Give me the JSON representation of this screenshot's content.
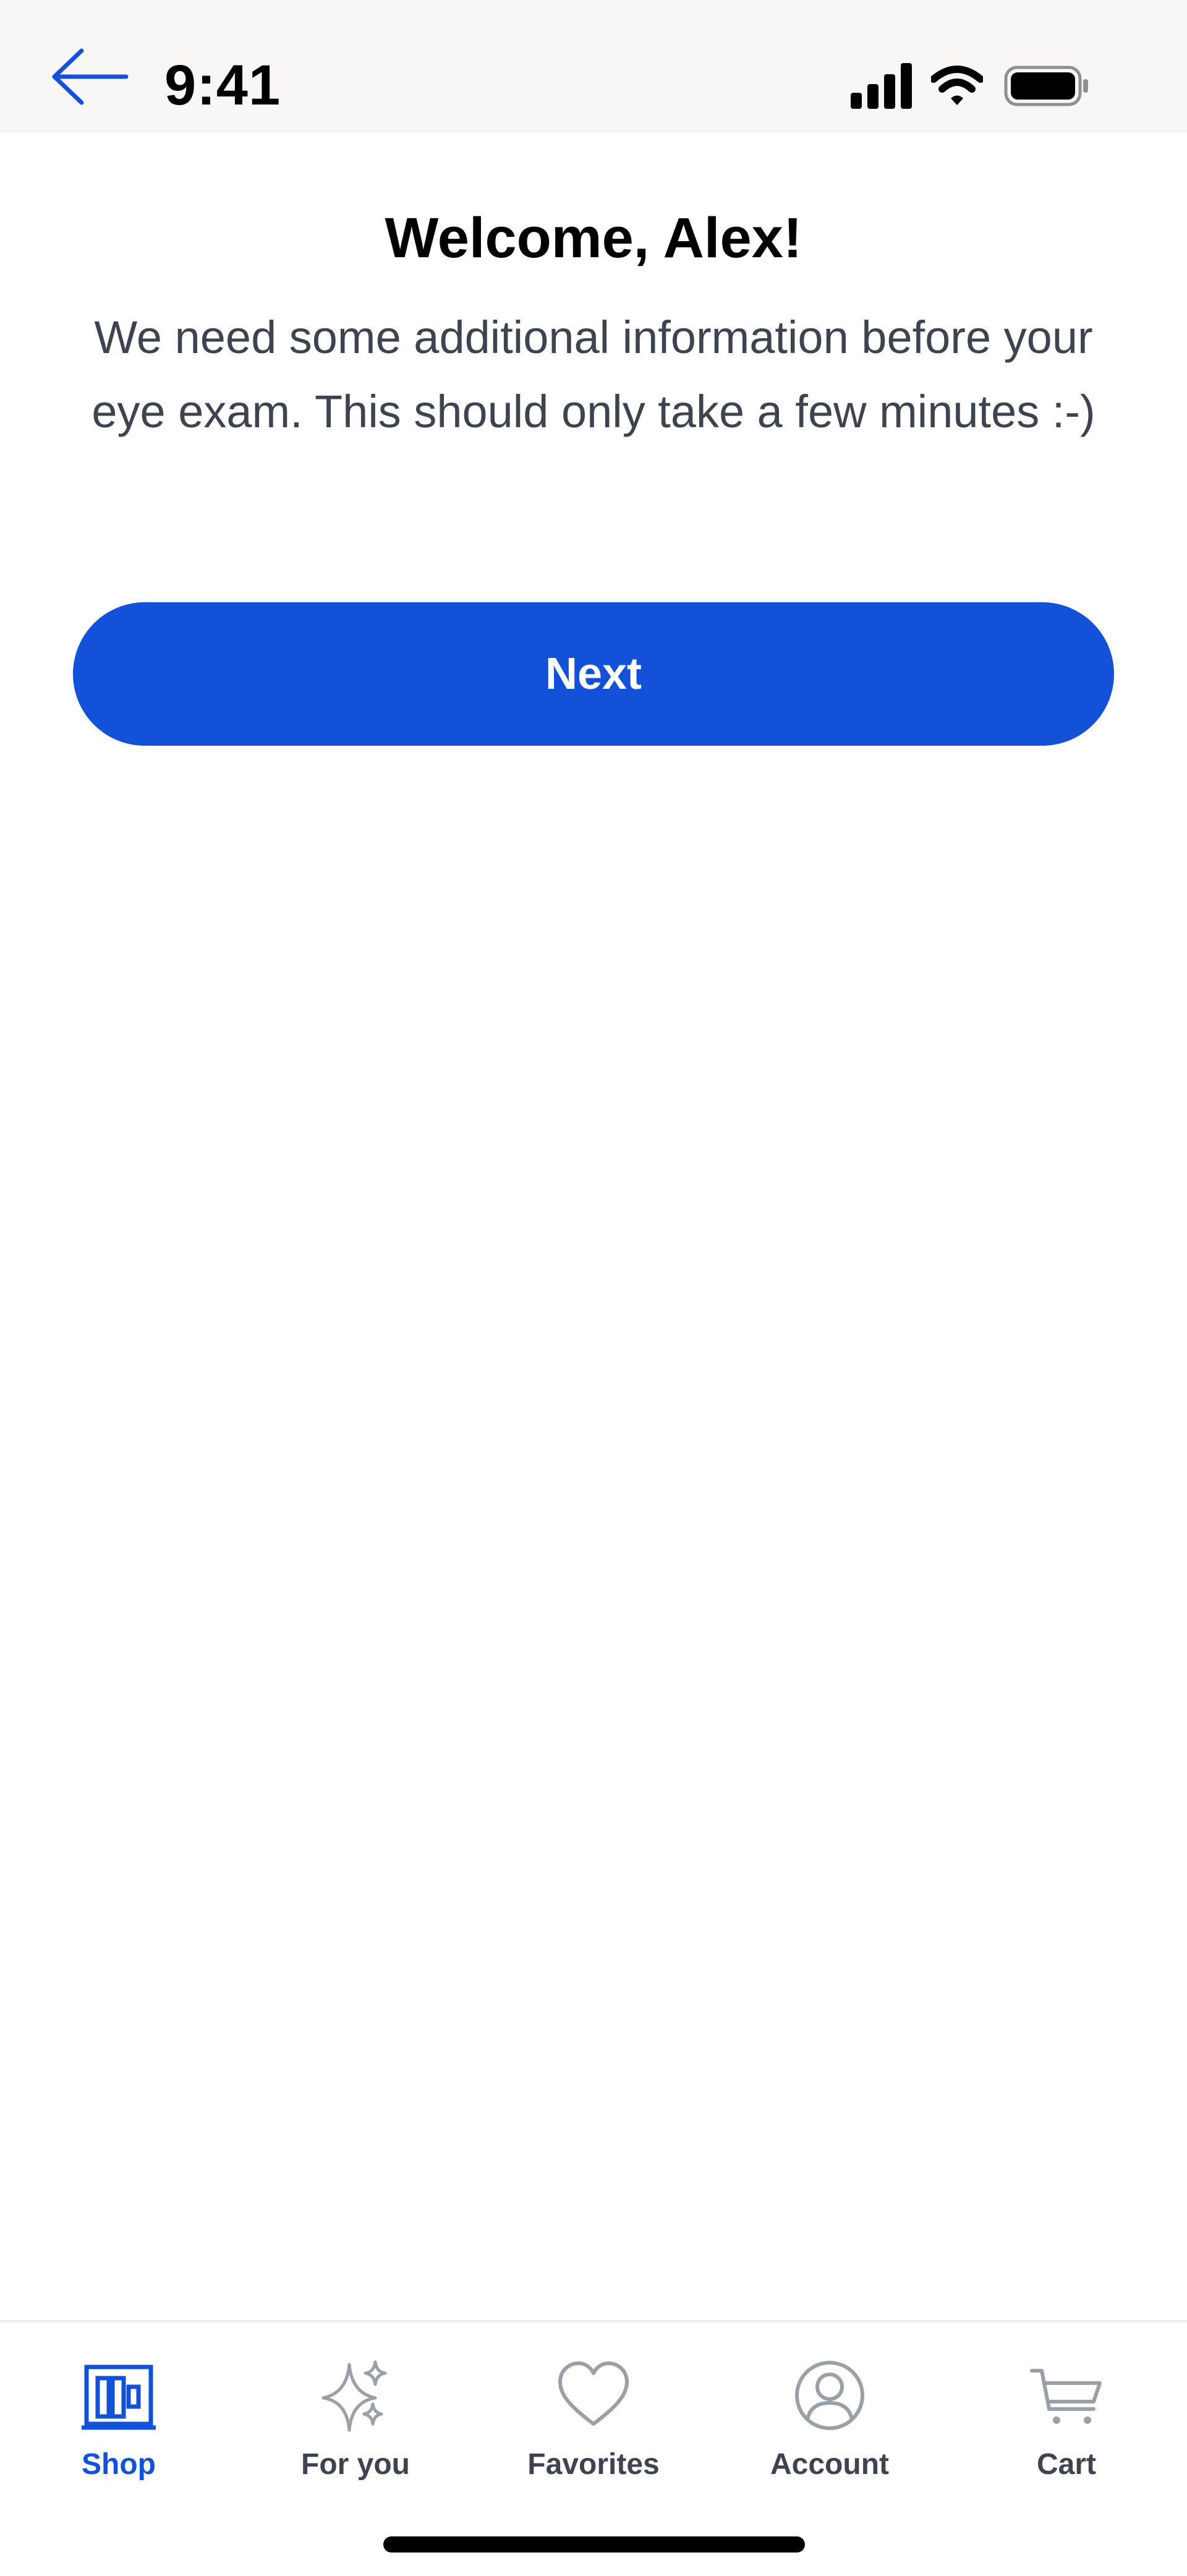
{
  "status_bar": {
    "time": "9:41"
  },
  "main": {
    "title": "Welcome, Alex!",
    "subtitle": "We need some additional information before your eye exam. This should only take a few minutes :-)",
    "next_label": "Next"
  },
  "tab_bar": {
    "items": [
      {
        "label": "Shop",
        "icon": "shop-icon",
        "active": true
      },
      {
        "label": "For you",
        "icon": "sparkle-icon",
        "active": false
      },
      {
        "label": "Favorites",
        "icon": "heart-icon",
        "active": false
      },
      {
        "label": "Account",
        "icon": "account-icon",
        "active": false
      },
      {
        "label": "Cart",
        "icon": "cart-icon",
        "active": false
      }
    ]
  },
  "colors": {
    "accent": "#1351d8",
    "status_bar_bg": "#f8f7f6",
    "body_text": "#3d4450",
    "inactive_icon": "#9aa0a8"
  }
}
